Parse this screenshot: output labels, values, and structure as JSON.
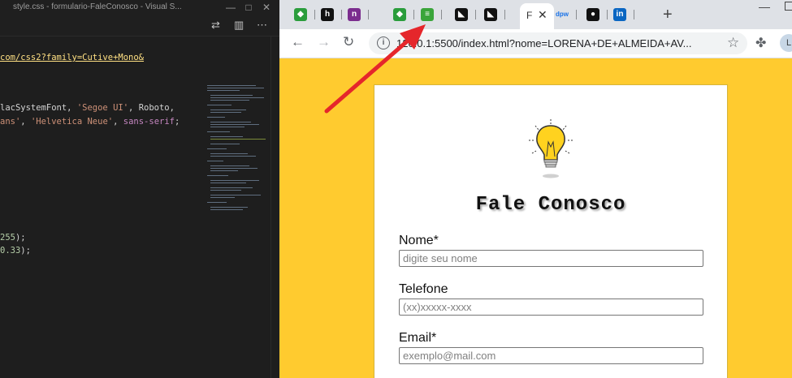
{
  "vscode": {
    "title": "style.css - formulario-FaleConosco - Visual S...",
    "window_controls": {
      "minimize": "—",
      "maximize": "□",
      "close": "✕"
    },
    "code": {
      "line1": "com/css2?family=Cutive+Mono&",
      "line2_a": "lacSystemFont, ",
      "line2_b": "'Segoe UI'",
      "line2_c": ", Roboto,",
      "line3_a": "ans'",
      "line3_b": ", ",
      "line3_c": "'Helvetica Neue'",
      "line3_d": ", ",
      "line3_e": "sans-serif",
      "line3_f": ";",
      "line4_a": "255",
      "line4_b": ");",
      "line5_a": "0.33",
      "line5_b": ");"
    }
  },
  "browser": {
    "active_tab_label": "F",
    "new_tab": "+",
    "url": "127.0.0.1:5500/index.html?nome=LORENA+DE+ALMEIDA+AV...",
    "url_display_prefix": "12",
    "url_display_rest": "0.0.1:5500/index.html?nome=LORENA+DE+ALMEIDA+AV...",
    "profile_initial": "L",
    "tabs": [
      {
        "icon": "github-desktop-icon",
        "glyph": "◆",
        "bg": "#2a9d3c"
      },
      {
        "icon": "hackerrank-icon",
        "glyph": "h",
        "bg": "#111111"
      },
      {
        "icon": "n-icon",
        "glyph": "n",
        "bg": "#7b2d8e"
      },
      {
        "icon": "github-desktop-icon",
        "glyph": "◆",
        "bg": "#2a9d3c"
      },
      {
        "icon": "notes-icon",
        "glyph": "≡",
        "bg": "#3aa53a"
      },
      {
        "icon": "gitbook-icon",
        "glyph": "◣",
        "bg": "#111111"
      },
      {
        "icon": "gitbook-icon",
        "glyph": "◣",
        "bg": "#111111"
      },
      {
        "icon": "dpw-icon",
        "glyph": "dpw",
        "bg": "#dee1e6"
      },
      {
        "icon": "github-icon",
        "glyph": "●",
        "bg": "#111111"
      },
      {
        "icon": "linkedin-icon",
        "glyph": "in",
        "bg": "#0a66c2"
      }
    ]
  },
  "page": {
    "title": "Fale Conosco",
    "fields": {
      "nome_label": "Nome*",
      "nome_placeholder": "digite seu nome",
      "telefone_label": "Telefone",
      "telefone_placeholder": "(xx)xxxxx-xxxx",
      "email_label": "Email*",
      "email_placeholder": "exemplo@mail.com"
    }
  },
  "colors": {
    "page_background": "#ffcb2f",
    "annotation_arrow": "#e5262b"
  }
}
